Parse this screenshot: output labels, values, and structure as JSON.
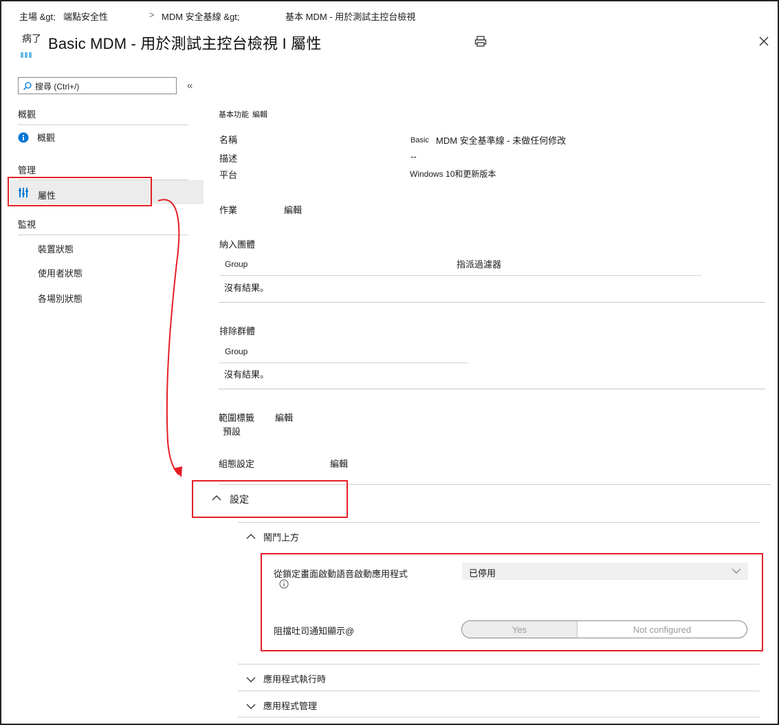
{
  "breadcrumb": {
    "home": "主場 &gt;",
    "endpoint": "端點安全性",
    "sep": ">",
    "mdm": "MDM 安全基線 &gt;",
    "current": "基本 MDM - 用於測試主控台檢視"
  },
  "header": {
    "icon_text": "病了",
    "title": "Basic  MDM - 用於測試主控台檢視 I 屬性"
  },
  "sidebar": {
    "search_placeholder": "搜尋 (Ctrl+/)",
    "collapse_glyph": "«",
    "overview_section": "概觀",
    "overview_item": "概觀",
    "manage_section": "管理",
    "properties_item": "屬性",
    "monitor_section": "監視",
    "monitor_items": [
      "裝置狀態",
      "使用者狀態",
      "各場別狀態"
    ]
  },
  "basics": {
    "heading": "基本功能",
    "edit": "編輯",
    "name_label": "名稱",
    "name_value_prefix": "Basic",
    "name_value": "MDM 安全基準線 - 未做任何修改",
    "desc_label": "描述",
    "desc_value": "--",
    "platform_label": "平台",
    "platform_value": "Windows 10和更新版本"
  },
  "assignments": {
    "heading": "作業",
    "edit": "編輯",
    "included_heading": "納入團體",
    "included_col_group": "Group",
    "included_col_filter": "指派過濾器",
    "included_empty": "沒有結果。",
    "excluded_heading": "排除群體",
    "excluded_col_group": "Group",
    "excluded_empty": "沒有結果。"
  },
  "scope": {
    "heading": "範圍標籤",
    "edit": "編輯",
    "value": "預設"
  },
  "config": {
    "heading": "組態設定",
    "edit": "編輯",
    "settings_label": "設定",
    "above_lock_label": "鬧鬥上方",
    "voice_label": "從鎖定畫面啟動語音啟動應用程式",
    "voice_value": "已停用",
    "toast_label": "阻擋吐司通知顯示@",
    "toggle_yes": "Yes",
    "toggle_nc": "Not configured",
    "app_runtime_label": "應用程式執行時",
    "app_mgmt_label": "應用程式管理"
  },
  "colors": {
    "highlight": "#e41e26",
    "accent": "#0078d4",
    "selected_bg": "#ececec"
  }
}
